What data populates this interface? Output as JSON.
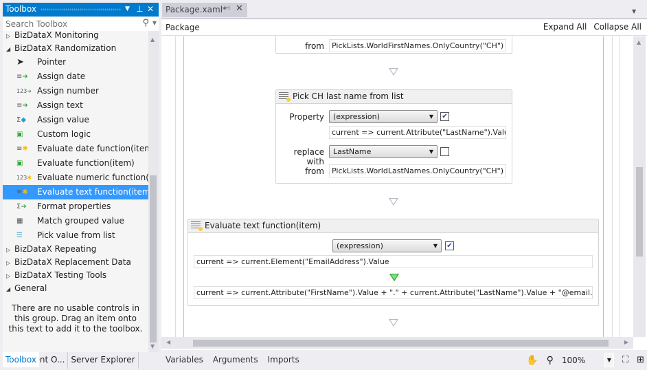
{
  "toolbox": {
    "title": "Toolbox",
    "search_placeholder": "Search Toolbox",
    "groups_top": [
      {
        "label": "BizDataX Monitoring",
        "expanded": false
      },
      {
        "label": "BizDataX Randomization",
        "expanded": true
      }
    ],
    "items": [
      {
        "label": "Pointer",
        "icon": "pointer-icon"
      },
      {
        "label": "Assign date",
        "icon": "assign-date-icon"
      },
      {
        "label": "Assign number",
        "icon": "assign-number-icon"
      },
      {
        "label": "Assign text",
        "icon": "assign-text-icon"
      },
      {
        "label": "Assign value",
        "icon": "assign-value-icon"
      },
      {
        "label": "Custom logic",
        "icon": "custom-logic-icon"
      },
      {
        "label": "Evaluate date function(item)",
        "icon": "evaluate-date-icon"
      },
      {
        "label": "Evaluate function(item)",
        "icon": "evaluate-function-icon"
      },
      {
        "label": "Evaluate numeric function(i...",
        "icon": "evaluate-numeric-icon"
      },
      {
        "label": "Evaluate text function(item)",
        "icon": "evaluate-text-icon",
        "selected": true
      },
      {
        "label": "Format properties",
        "icon": "format-properties-icon"
      },
      {
        "label": "Match grouped value",
        "icon": "match-grouped-icon"
      },
      {
        "label": "Pick value from list",
        "icon": "pick-list-icon"
      }
    ],
    "groups_bottom": [
      {
        "label": "BizDataX Repeating"
      },
      {
        "label": "BizDataX Replacement Data"
      },
      {
        "label": "BizDataX Testing Tools"
      },
      {
        "label": "General",
        "expanded": true
      }
    ],
    "empty_message": "There are no usable controls in this group. Drag an item onto this text to add it to the toolbox.",
    "bottom_tabs": [
      "Document O...",
      "Server Explorer",
      "Toolbox"
    ],
    "active_tab": "Toolbox"
  },
  "document_tab": {
    "label": "Package.xaml*"
  },
  "designer": {
    "breadcrumb": "Package",
    "expand_all": "Expand All",
    "collapse_all": "Collapse All",
    "activity1": {
      "from_label": "from",
      "from_value": "PickLists.WorldFirstNames.OnlyCountry(\"CH\")"
    },
    "activity2": {
      "title": "Pick CH last name from list",
      "property_label": "Property",
      "property_select": "(expression)",
      "property_checked": true,
      "property_expr": "current => current.Attribute(\"LastName\").Value",
      "replace_label": "replace with",
      "replace_select": "LastName",
      "replace_checked": false,
      "from_label": "from",
      "from_value": "PickLists.WorldLastNames.OnlyCountry(\"CH\")"
    },
    "activity3": {
      "title": "Evaluate text function(item)",
      "select": "(expression)",
      "checked": true,
      "input_expr": "current => current.Element(\"EmailAddress\").Value",
      "output_expr": "current => current.Attribute(\"FirstName\").Value + \".\" + current.Attribute(\"LastName\").Value + \"@email.com\""
    }
  },
  "footer": {
    "variables": "Variables",
    "arguments": "Arguments",
    "imports": "Imports",
    "zoom": "100%"
  },
  "colors": {
    "accent": "#007acc",
    "selection": "#3399ff"
  }
}
